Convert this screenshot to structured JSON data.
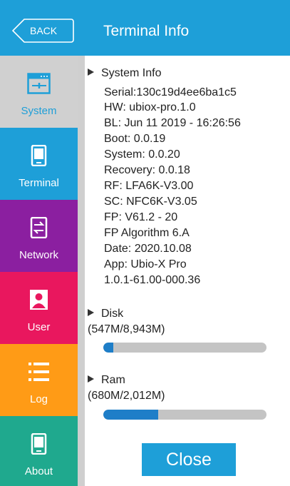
{
  "header": {
    "back_label": "BACK",
    "title": "Terminal Info"
  },
  "sidebar": {
    "items": [
      {
        "label": "System",
        "icon": "system-settings-icon",
        "color": "#d0d0d0",
        "active": true
      },
      {
        "label": "Terminal",
        "icon": "terminal-device-icon",
        "color": "#1e9fd8"
      },
      {
        "label": "Network",
        "icon": "network-transfer-icon",
        "color": "#8b1fa0"
      },
      {
        "label": "User",
        "icon": "user-icon",
        "color": "#e9175e"
      },
      {
        "label": "Log",
        "icon": "log-list-icon",
        "color": "#ff9b16"
      },
      {
        "label": "About",
        "icon": "about-device-icon",
        "color": "#1fa98e"
      }
    ]
  },
  "system_info": {
    "heading": "System Info",
    "lines": [
      "Serial:130c19d4ee6ba1c5",
      "HW: ubiox-pro.1.0",
      "BL: Jun 11 2019 - 16:26:56",
      "Boot: 0.0.19",
      "System: 0.0.20",
      "Recovery: 0.0.18",
      "RF: LFA6K-V3.00",
      "SC: NFC6K-V3.05",
      "FP: V61.2 - 20",
      "FP Algorithm 6.A",
      "Date: 2020.10.08",
      "App: Ubio-X Pro",
      "1.0.1-61.00-000.36"
    ]
  },
  "disk": {
    "heading": "Disk",
    "usage": "(547M/8,943M)",
    "fraction": 0.061
  },
  "ram": {
    "heading": "Ram",
    "usage": "(680M/2,012M)",
    "fraction": 0.338
  },
  "close_label": "Close",
  "colors": {
    "accent": "#1e9fd8",
    "bar_fill": "#1e7ec8",
    "bar_track": "#c4c4c4"
  }
}
